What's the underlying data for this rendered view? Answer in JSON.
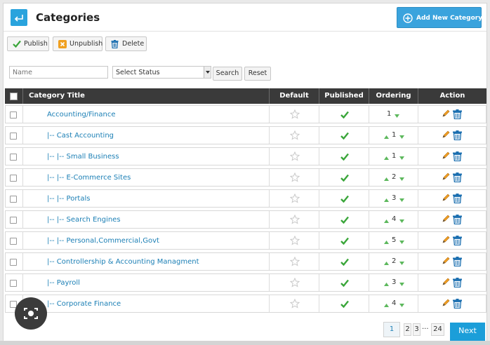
{
  "header": {
    "title": "Categories",
    "add_button_label": "Add New Category"
  },
  "toolbar": {
    "publish_label": "Publish",
    "unpublish_label": "Unpublish",
    "delete_label": "Delete"
  },
  "filters": {
    "name_placeholder": "Name",
    "status_selected": "Select Status",
    "search_label": "Search",
    "reset_label": "Reset"
  },
  "table": {
    "columns": [
      "Category Title",
      "Default",
      "Published",
      "Ordering",
      "Action"
    ],
    "rows": [
      {
        "title": "Accounting/Finance",
        "order": "1",
        "up": false,
        "down": true
      },
      {
        "title": "|-- Cast Accounting",
        "order": "1",
        "up": true,
        "down": true
      },
      {
        "title": "|-- |-- Small Business",
        "order": "1",
        "up": true,
        "down": true
      },
      {
        "title": "|-- |-- E-Commerce Sites",
        "order": "2",
        "up": true,
        "down": true
      },
      {
        "title": "|-- |-- Portals",
        "order": "3",
        "up": true,
        "down": true
      },
      {
        "title": "|-- |-- Search Engines",
        "order": "4",
        "up": true,
        "down": true
      },
      {
        "title": "|-- |-- Personal,Commercial,Govt",
        "order": "5",
        "up": true,
        "down": true
      },
      {
        "title": "|-- Controllership & Accounting Managment",
        "order": "2",
        "up": true,
        "down": true
      },
      {
        "title": "|-- Payroll",
        "order": "3",
        "up": true,
        "down": true
      },
      {
        "title": "|-- Corporate Finance",
        "order": "4",
        "up": true,
        "down": true
      }
    ]
  },
  "pagination": {
    "pages": [
      "1",
      "2",
      "3",
      "...",
      "24"
    ],
    "current": "1",
    "next_label": "Next"
  },
  "colors": {
    "accent": "#29a3dd",
    "link": "#1b7fb5",
    "header_bg": "#3a3a3a",
    "check": "#3aa63a",
    "arrow": "#5cb85c"
  }
}
